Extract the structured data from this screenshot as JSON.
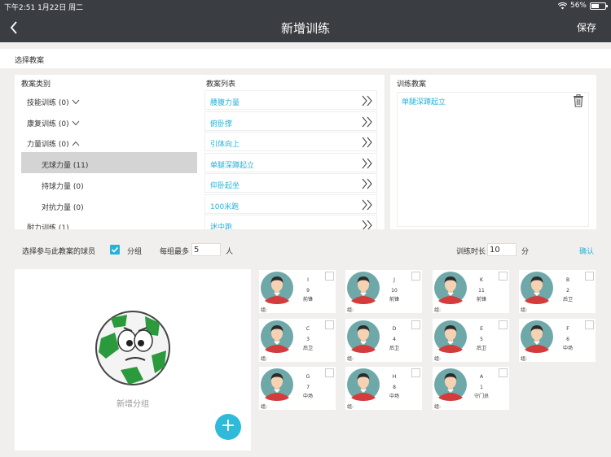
{
  "status": {
    "time": "下午2:51  1月22日 周二",
    "battery": "56%",
    "battery_fraction": 0.56
  },
  "nav": {
    "title": "新增训练",
    "save_label": "保存"
  },
  "section": {
    "title": "选择教案"
  },
  "columns": {
    "categories_header": "教案类别",
    "plans_header": "教案列表",
    "training_header": "训练教案"
  },
  "categories": [
    {
      "label": "技能训练 (0)",
      "chevron": "down"
    },
    {
      "label": "康复训练 (0)",
      "chevron": "down"
    },
    {
      "label": "力量训练 (0)",
      "chevron": "up"
    },
    {
      "label": "无球力量 (11)",
      "sub": true,
      "active": true
    },
    {
      "label": "持球力量 (0)",
      "sub": true
    },
    {
      "label": "对抗力量 (0)",
      "sub": true
    },
    {
      "label": "耐力训练 (1)"
    }
  ],
  "plans": [
    "腰腹力量",
    "俯卧撑",
    "引体向上",
    "单腿深蹲起立",
    "仰卧起坐",
    "100米跑",
    "迷中跑"
  ],
  "training": {
    "items": [
      "单腿深蹲起立"
    ]
  },
  "options": {
    "select_players_label": "选择参与此教案的球员",
    "group_label": "分组",
    "max_per_group_label": "每组最多",
    "max_per_group_value": "5",
    "person_unit": "人",
    "duration_label": "训练时长",
    "duration_value": "10",
    "minute_unit": "分",
    "confirm_label": "确认"
  },
  "group": {
    "new_group_label": "新增分组",
    "add_icon": "+"
  },
  "players": [
    {
      "name": "I",
      "number": "9",
      "position": "前锋",
      "group": "组:"
    },
    {
      "name": "J",
      "number": "10",
      "position": "前锋",
      "group": "组:"
    },
    {
      "name": "K",
      "number": "11",
      "position": "前锋",
      "group": "组:"
    },
    {
      "name": "B",
      "number": "2",
      "position": "后卫",
      "group": "组:"
    },
    {
      "name": "C",
      "number": "3",
      "position": "后卫",
      "group": "组:"
    },
    {
      "name": "D",
      "number": "4",
      "position": "后卫",
      "group": "组:"
    },
    {
      "name": "E",
      "number": "5",
      "position": "后卫",
      "group": "组:"
    },
    {
      "name": "F",
      "number": "6",
      "position": "中场",
      "group": "组:"
    },
    {
      "name": "G",
      "number": "7",
      "position": "中场",
      "group": "组:"
    },
    {
      "name": "H",
      "number": "8",
      "position": "中场",
      "group": "组:"
    },
    {
      "name": "A",
      "number": "1",
      "position": "守门员",
      "group": "组:"
    }
  ],
  "colors": {
    "accent": "#27b2d8",
    "navbar": "#3a3d42",
    "background": "#f0efed"
  }
}
